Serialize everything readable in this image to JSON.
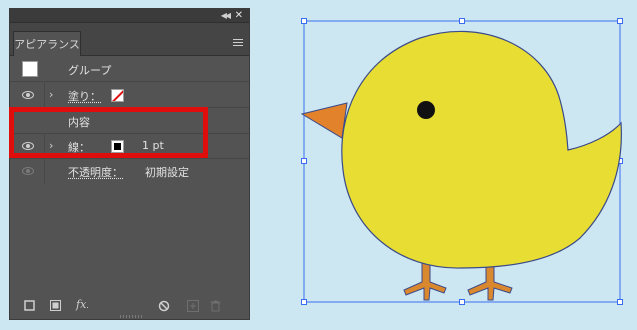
{
  "panel": {
    "collapse_icon": "double-chevron-left-icon",
    "close_icon": "close-icon",
    "tab_label": "アピアランス",
    "menu_icon": "hamburger-menu-icon",
    "rows": {
      "group_label": "グループ",
      "fill_label": "塗り：",
      "contents_label": "内容",
      "stroke_label": "線：",
      "stroke_weight": "1 pt",
      "opacity_label": "不透明度：",
      "opacity_value": "初期設定"
    },
    "footer": {
      "new_stroke_icon": "add-new-stroke-icon",
      "new_fill_icon": "add-new-fill-icon",
      "fx_label": "fx",
      "clear_icon": "clear-appearance-icon",
      "duplicate_icon": "duplicate-item-icon",
      "delete_icon": "trash-icon"
    },
    "colors": {
      "panel_bg": "#535353",
      "highlight": "#e00d0d",
      "none_slash": "#e01010"
    }
  },
  "artwork": {
    "subject": "chick illustration",
    "colors": {
      "body": "#e8dd33",
      "beak": "#e2822a",
      "feet": "#d9882e",
      "outline": "#3a4a8a",
      "selection": "#3a6cf0",
      "canvas": "#cde7f2"
    }
  }
}
